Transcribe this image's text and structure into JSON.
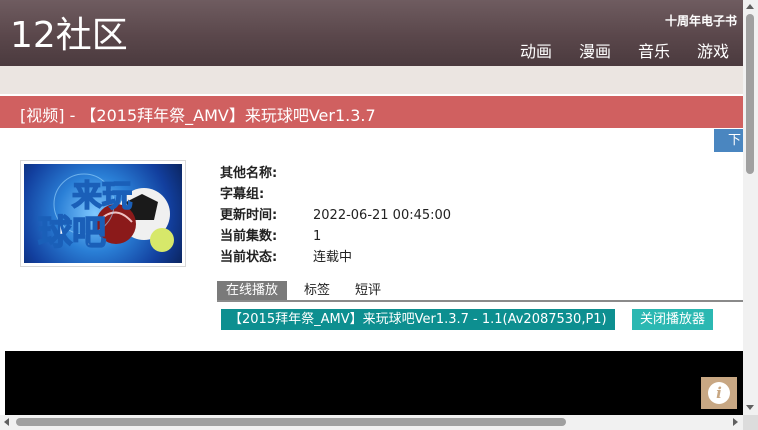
{
  "header": {
    "logo": "12社区",
    "tagline": "十周年电子书",
    "nav": [
      "动画",
      "漫画",
      "音乐",
      "游戏"
    ]
  },
  "title": "[视频] - 【2015拜年祭_AMV】来玩球吧Ver1.3.7",
  "side_button": "下",
  "cover": {
    "art_text_top": "来玩",
    "art_text_bottom": "球吧"
  },
  "info": {
    "rows": [
      {
        "label": "其他名称:",
        "value": ""
      },
      {
        "label": "字幕组:",
        "value": ""
      },
      {
        "label": "更新时间:",
        "value": "2022-06-21 00:45:00"
      },
      {
        "label": "当前集数:",
        "value": "1"
      },
      {
        "label": "当前状态:",
        "value": "连载中"
      }
    ]
  },
  "tabs": [
    "在线播放",
    "标签",
    "短评"
  ],
  "episode_button": "【2015拜年祭_AMV】来玩球吧Ver1.3.7 - 1.1(Av2087530,P1)",
  "close_player_button": "关闭播放器",
  "info_icon": "i",
  "colors": {
    "header": "#5a474b",
    "title_bar": "#d06060",
    "episode_button": "#0d8f90",
    "close_button": "#2bb8b2",
    "side_button": "#4a86c0"
  }
}
